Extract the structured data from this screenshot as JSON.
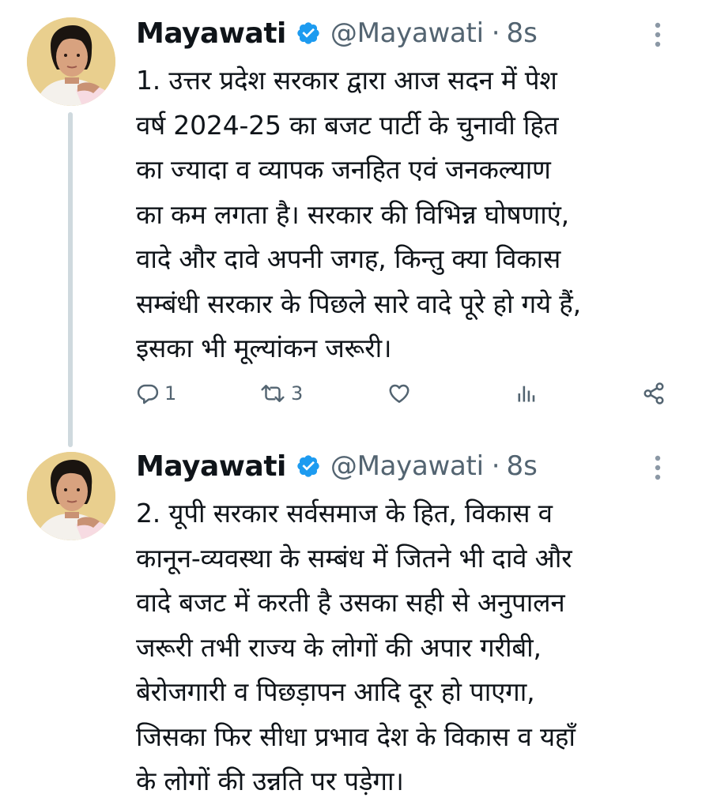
{
  "tweets": [
    {
      "author": {
        "name": "Mayawati",
        "handle": "@Mayawati",
        "verified": true
      },
      "separator": "·",
      "time": "8s",
      "text": "1. उत्तर प्रदेश सरकार द्वारा आज सदन में पेश\nवर्ष 2024-25 का बजट पार्टी के चुनावी हित\nका ज्यादा व व्यापक जनहित एवं जनकल्याण\nका कम लगता है। सरकार की विभिन्न घोषणाएं,\nवादे और दावे अपनी जगह, किन्तु क्या विकास\nसम्बंधी सरकार के पिछले सारे वादे पूरे हो गये हैं,\nइसका भी मूल्यांकन जरूरी।",
      "actions": {
        "reply_count": "1",
        "retweet_count": "3"
      },
      "icons": [
        "avatar",
        "verified-badge-icon",
        "more-options-icon",
        "reply-icon",
        "retweet-icon",
        "like-icon",
        "views-icon",
        "share-icon"
      ]
    },
    {
      "author": {
        "name": "Mayawati",
        "handle": "@Mayawati",
        "verified": true
      },
      "separator": "·",
      "time": "8s",
      "text": "2. यूपी सरकार सर्वसमाज के हित, विकास व\nकानून-व्यवस्था के सम्बंध में जितने भी दावे और\nवादे बजट में करती है उसका सही से अनुपालन\nजरूरी तभी राज्य के लोगों की अपार गरीबी,\nबेरोजगारी व पिछड़ापन आदि दूर हो पाएगा,\nजिसका फिर सीधा प्रभाव देश के विकास व यहाँ\nके लोगों की उन्नति पर पड़ेगा।",
      "icons": [
        "avatar",
        "verified-badge-icon",
        "more-options-icon"
      ]
    }
  ],
  "colors": {
    "text": "#0f1419",
    "secondary": "#536471",
    "verified_blue": "#1d9bf0",
    "thread_line": "#cfd9de",
    "avatar_bg": "#e9cf8e"
  }
}
